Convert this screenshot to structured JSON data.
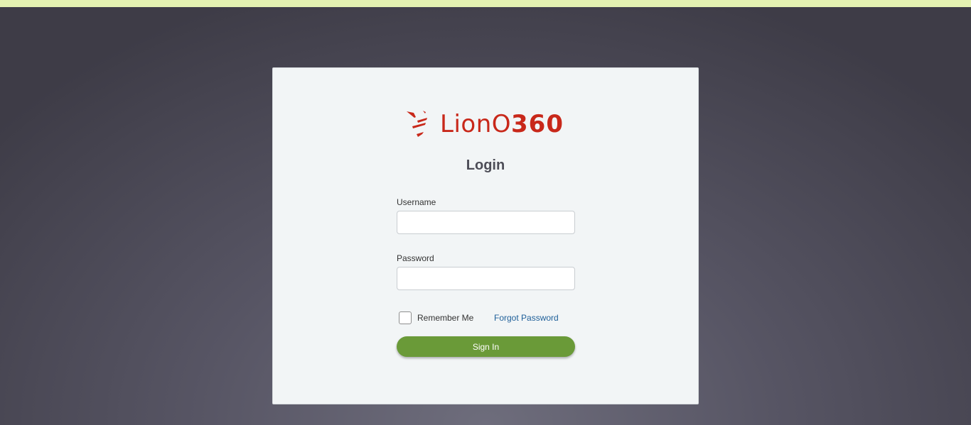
{
  "brand": {
    "name_light": "LionO",
    "name_bold": "360",
    "color": "#c8281a"
  },
  "login": {
    "title": "Login",
    "username_label": "Username",
    "username_value": "",
    "password_label": "Password",
    "password_value": "",
    "remember_label": "Remember Me",
    "remember_checked": false,
    "forgot_label": "Forgot Password",
    "signin_label": "Sign In"
  },
  "colors": {
    "top_strip": "#e3f1b1",
    "card_background": "#f2f5f6",
    "signin_button": "#6a9a38",
    "link": "#1e5f99"
  }
}
